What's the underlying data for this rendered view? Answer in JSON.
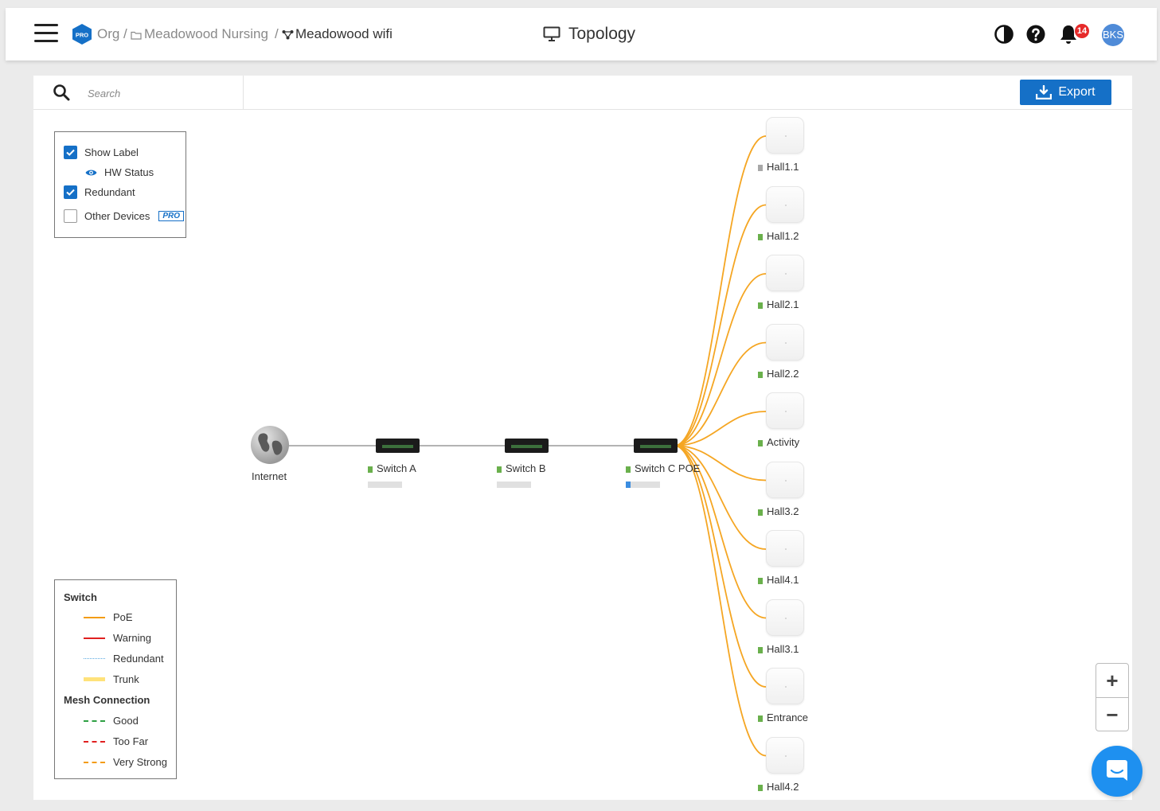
{
  "header": {
    "breadcrumb": {
      "org": "Org /",
      "site": "Meadowood Nursing",
      "separator": "/",
      "network": "Meadowood wifi"
    },
    "title": "Topology",
    "notifications_count": "14",
    "avatar_initials": "BKS",
    "pro_badge": "PRO"
  },
  "toolbar": {
    "search_placeholder": "Search",
    "export_label": "Export"
  },
  "options": {
    "show_label": {
      "label": "Show Label",
      "checked": true
    },
    "hw_status": {
      "label": "HW Status"
    },
    "redundant": {
      "label": "Redundant",
      "checked": true
    },
    "other_devices": {
      "label": "Other Devices",
      "checked": false,
      "tag": "PRO"
    }
  },
  "legend": {
    "switch_title": "Switch",
    "switch_items": [
      {
        "label": "PoE",
        "color": "#f39c12",
        "style": "solid"
      },
      {
        "label": "Warning",
        "color": "#e02020",
        "style": "solid"
      },
      {
        "label": "Redundant",
        "color": "#5aa8e0",
        "style": "dotted"
      },
      {
        "label": "Trunk",
        "color": "#ffe27a",
        "style": "thick"
      }
    ],
    "mesh_title": "Mesh Connection",
    "mesh_items": [
      {
        "label": "Good",
        "color": "#2ea043",
        "style": "dashed"
      },
      {
        "label": "Too Far",
        "color": "#e02020",
        "style": "dashed"
      },
      {
        "label": "Very Strong",
        "color": "#f39c12",
        "style": "dashed"
      }
    ]
  },
  "topology": {
    "internet": {
      "label": "Internet"
    },
    "switches": [
      {
        "label": "Switch A",
        "status": "online"
      },
      {
        "label": "Switch B",
        "status": "online"
      },
      {
        "label": "Switch C POE",
        "status": "online"
      }
    ],
    "access_points": [
      {
        "label": "Hall1.1",
        "status": "offline"
      },
      {
        "label": "Hall1.2",
        "status": "online"
      },
      {
        "label": "Hall2.1",
        "status": "online"
      },
      {
        "label": "Hall2.2",
        "status": "online"
      },
      {
        "label": "Activity",
        "status": "online"
      },
      {
        "label": "Hall3.2",
        "status": "online"
      },
      {
        "label": "Hall4.1",
        "status": "online"
      },
      {
        "label": "Hall3.1",
        "status": "online"
      },
      {
        "label": "Entrance",
        "status": "online"
      },
      {
        "label": "Hall4.2",
        "status": "online"
      }
    ],
    "colors": {
      "online": "#6ab04c",
      "offline": "#a8a8a8",
      "poe_link": "#f5a623",
      "uplink": "#9a9a9a",
      "accent": "#1570c7"
    }
  },
  "zoom": {
    "in": "+",
    "out": "−"
  }
}
